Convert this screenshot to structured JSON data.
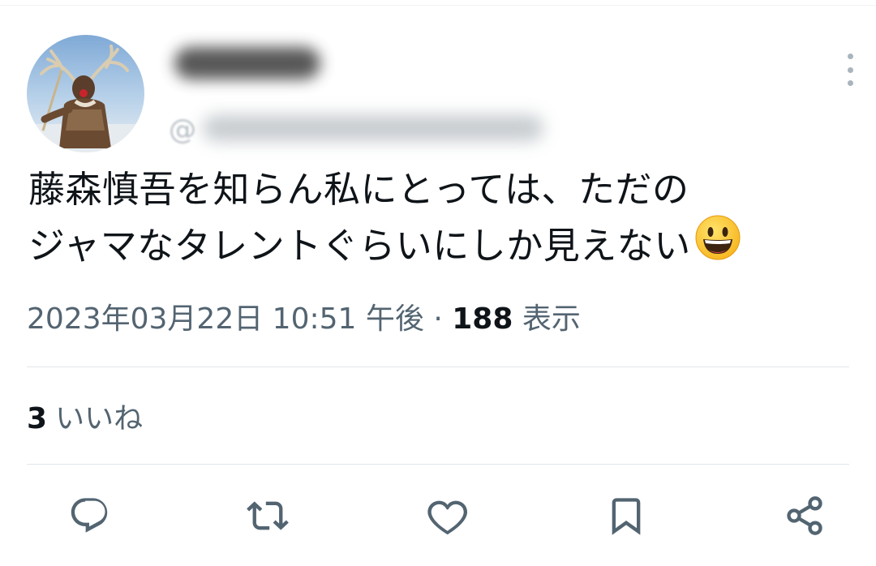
{
  "tweet": {
    "handle_prefix": "@",
    "text_line1": "藤森慎吾を知らん私にとっては、ただの",
    "text_line2": "ジャマなタレントぐらいにしか見えない",
    "emoji": "grinning-face",
    "timestamp": "2023年03月22日 10:51 午後",
    "separator": "·",
    "views_count": "188",
    "views_label": "表示"
  },
  "stats": {
    "likes_count": "3",
    "likes_label": "いいね"
  },
  "actions": [
    "reply-icon",
    "retweet-icon",
    "like-icon",
    "bookmark-icon",
    "share-icon"
  ],
  "colors": {
    "text": "#0f1419",
    "secondary": "#536471",
    "divider": "#e1e6e9",
    "icon": "#536471"
  }
}
